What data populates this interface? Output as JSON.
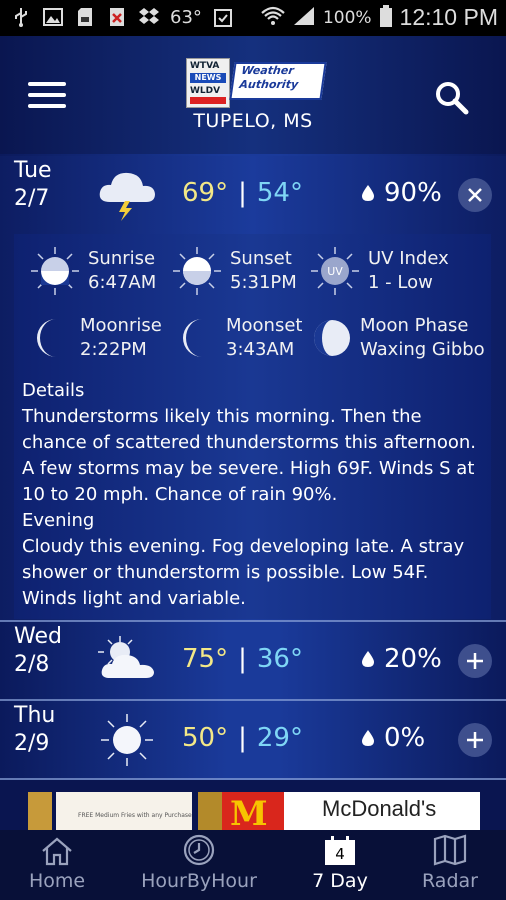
{
  "status_bar": {
    "temp": "63°",
    "battery": "100%",
    "time": "12:10 PM"
  },
  "header": {
    "logo_lines": [
      "WTVA",
      "NEWS",
      "WLDV",
      "Weather",
      "Authority"
    ],
    "city": "TUPELO, MS"
  },
  "days": [
    {
      "day": "Tue",
      "date": "2/7",
      "icon": "thunderstorm-icon",
      "hi": "69°",
      "sep": "|",
      "lo": "54°",
      "rain": "90%",
      "expanded": true
    },
    {
      "day": "Wed",
      "date": "2/8",
      "icon": "partly-cloudy-icon",
      "hi": "75°",
      "sep": "|",
      "lo": "36°",
      "rain": "20%",
      "expanded": false
    },
    {
      "day": "Thu",
      "date": "2/9",
      "icon": "sunny-icon",
      "hi": "50°",
      "sep": "|",
      "lo": "29°",
      "rain": "0%",
      "expanded": false
    }
  ],
  "astro": {
    "sunrise_label": "Sunrise",
    "sunrise": "6:47AM",
    "sunset_label": "Sunset",
    "sunset": "5:31PM",
    "uv_label": "UV Index",
    "uv": "1 - Low",
    "uv_badge": "UV",
    "moonrise_label": "Moonrise",
    "moonrise": "2:22PM",
    "moonset_label": "Moonset",
    "moonset": "3:43AM",
    "phase_label": "Moon Phase",
    "phase": "Waxing Gibbo"
  },
  "details": {
    "title": "Details",
    "day_text": "Thunderstorms likely this morning. Then the chance of scattered thunderstorms this afternoon. A few storms may be severe. High 69F. Winds S at 10 to 20 mph. Chance of rain 90%.",
    "evening_title": "Evening",
    "evening_text": "Cloudy this evening. Fog developing late. A stray shower or thunderstorm is possible. Low 54F. Winds light and variable."
  },
  "ad": {
    "small_text": "FREE Medium Fries with any Purchase",
    "brand": "McDonald's",
    "logo_letter": "M"
  },
  "nav": {
    "home": "Home",
    "hour": "HourByHour",
    "seven_day": "7 Day",
    "seven_day_badge": "4",
    "radar": "Radar"
  },
  "colors": {
    "hi_temp": "#f3e887",
    "lo_temp": "#7fd6f5",
    "background": "#1a3a9a"
  }
}
